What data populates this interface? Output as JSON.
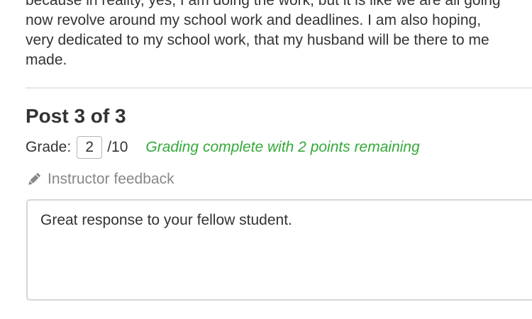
{
  "post_body": {
    "lines": [
      "because in reality, yes, I am doing the work, but it is like we are all going",
      "now revolve around my school work and deadlines.  I am also hoping,",
      "very dedicated to my school work, that my husband will be there to me",
      "made."
    ]
  },
  "post": {
    "heading": "Post 3 of 3",
    "grade_label": "Grade:",
    "grade_value": "2",
    "grade_max": "/10",
    "grading_status": "Grading complete with 2 points remaining"
  },
  "feedback": {
    "label": "Instructor feedback",
    "icon": "pencil-icon",
    "text": "Great response to your fellow student."
  },
  "colors": {
    "status_green": "#34a93a",
    "muted_gray": "#888888",
    "text": "#333333"
  }
}
